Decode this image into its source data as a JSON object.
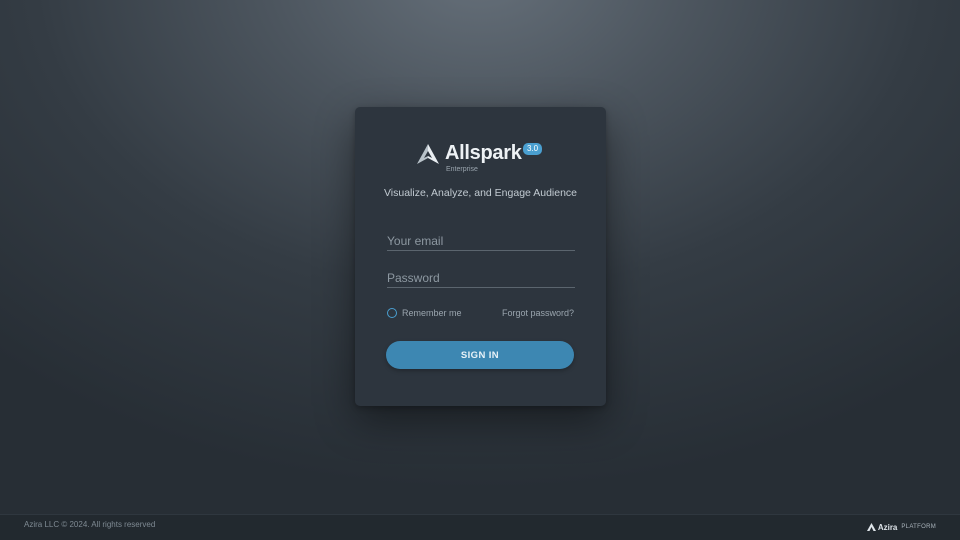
{
  "app": {
    "name": "Allspark",
    "version": "3.0",
    "edition": "Enterprise",
    "tagline": "Visualize, Analyze, and Engage Audience",
    "logo_icon": "allspark-logo-icon"
  },
  "login": {
    "email_placeholder": "Your email",
    "password_placeholder": "Password",
    "remember_label": "Remember me",
    "forgot_label": "Forgot password?",
    "signin_label": "SIGN IN"
  },
  "footer": {
    "copyright": "Azira LLC © 2024. All rights reserved",
    "brand_name": "Azira",
    "brand_suffix": "PLATFORM",
    "brand_icon": "azira-logo-icon"
  },
  "colors": {
    "accent": "#3d87b2",
    "badge": "#4a9fd0",
    "card": "#2d353e",
    "footer": "#22292f"
  }
}
